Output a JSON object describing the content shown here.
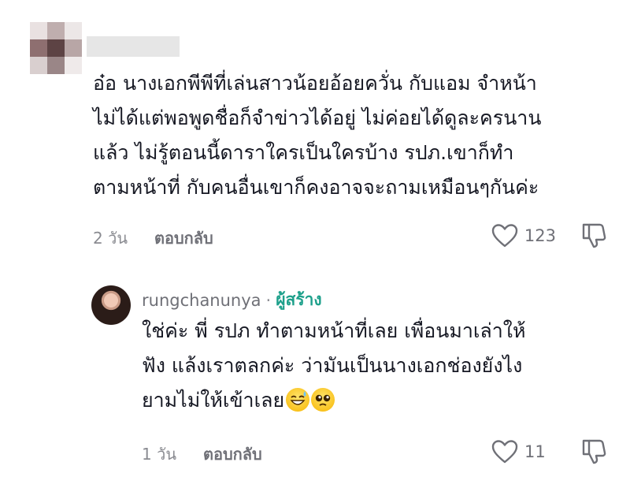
{
  "comment": {
    "lines": [
      "อ๋อ นางเอกพีพีที่เล่นสาวน้อยอ้อยควั่น กับแอม จำหน้า",
      "ไม่ได้แต่พอพูดชื่อก็จำข่าวได้อยู่ ไม่ค่อยได้ดูละครนาน",
      "แล้ว ไม่รู้ตอนนี้ดาราใครเป็นใครบ้าง รปภ.เขาก็ทำ",
      "ตามหน้าที่ กับคนอื่นเขาก็คงอาจจะถามเหมือนๆกันค่ะ"
    ],
    "time": "2 วัน",
    "reply_label": "ตอบกลับ",
    "like_count": "123",
    "like_icon": "heart-outline-icon",
    "dislike_icon": "thumbs-down-outline-icon"
  },
  "reply": {
    "username": "rungchanunya",
    "separator": "·",
    "creator_badge": "ผู้สร้าง",
    "lines": [
      "ใช่ค่ะ พี่ รปภ ทำตามหน้าที่เลย เพื่อนมาเล่าให้",
      "ฟัง แล้งเราตลกค่ะ ว่ามันเป็นนางเอกช่องยังไง",
      "ยามไม่ให้เข้าเลย"
    ],
    "emojis": [
      "sweat-smile-emoji",
      "pleading-face-emoji"
    ],
    "time": "1 วัน",
    "reply_label": "ตอบกลับ",
    "like_count": "11",
    "accent_color": "#1da08b"
  }
}
